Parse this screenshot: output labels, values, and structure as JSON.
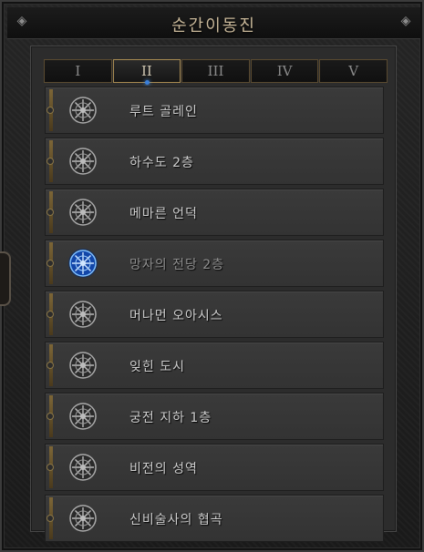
{
  "window": {
    "title": "순간이동진"
  },
  "tabs": [
    {
      "label": "I",
      "active": false
    },
    {
      "label": "II",
      "active": true
    },
    {
      "label": "III",
      "active": false
    },
    {
      "label": "IV",
      "active": false
    },
    {
      "label": "V",
      "active": false
    }
  ],
  "waypoints": [
    {
      "label": "루트 골레인",
      "icon": "waypoint-icon"
    },
    {
      "label": "하수도 2층",
      "icon": "waypoint-icon"
    },
    {
      "label": "메마른 언덕",
      "icon": "waypoint-icon"
    },
    {
      "label": "망자의 전당 2층",
      "icon": "waypoint-active-icon"
    },
    {
      "label": "머나먼 오아시스",
      "icon": "waypoint-icon"
    },
    {
      "label": "잊힌 도시",
      "icon": "waypoint-icon"
    },
    {
      "label": "궁전 지하 1층",
      "icon": "waypoint-icon"
    },
    {
      "label": "비전의 성역",
      "icon": "waypoint-icon"
    },
    {
      "label": "신비술사의 협곡",
      "icon": "waypoint-icon"
    }
  ],
  "colors": {
    "accent_gold": "#a88b52",
    "active_waypoint_blue": "#3b7fd9"
  }
}
